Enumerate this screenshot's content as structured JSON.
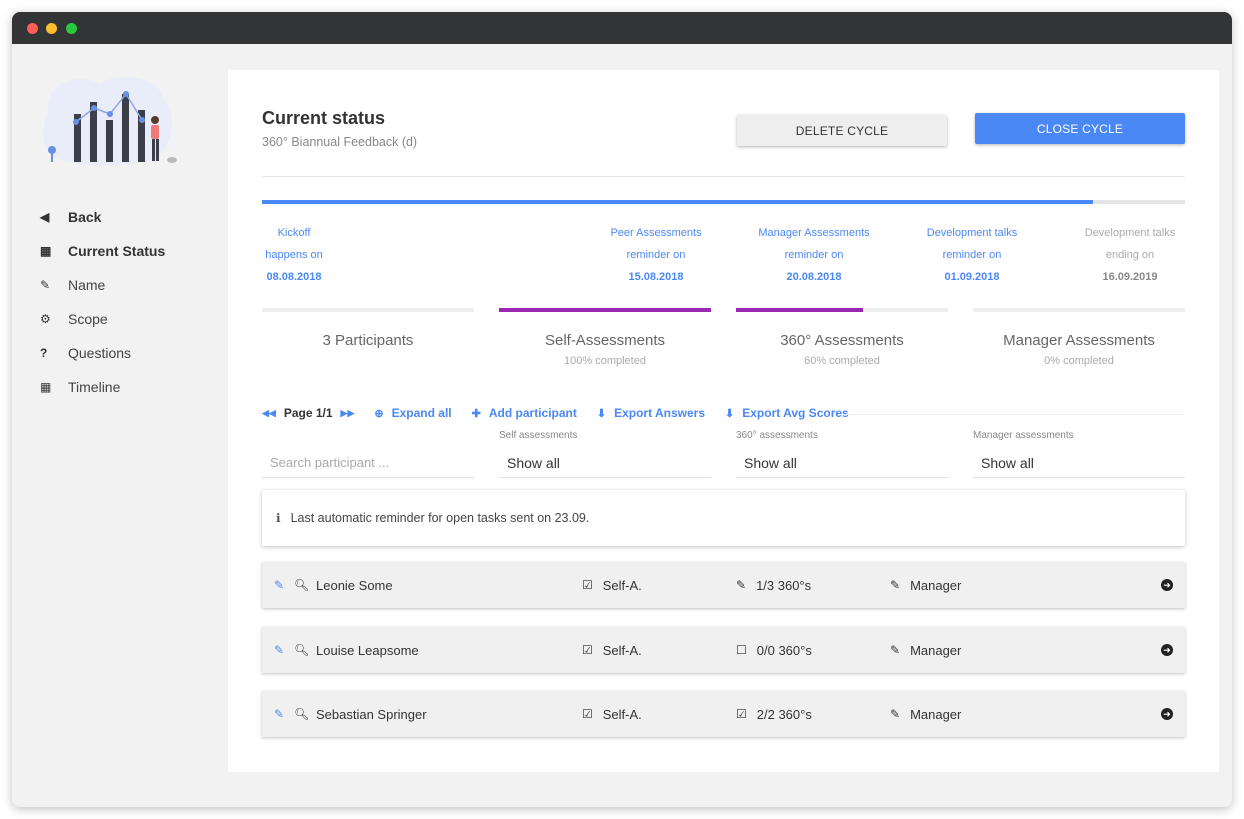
{
  "sidebar": {
    "items": [
      {
        "label": "Back",
        "icon": "caret-left-icon"
      },
      {
        "label": "Current Status",
        "icon": "calendar-icon"
      },
      {
        "label": "Name",
        "icon": "edit-icon"
      },
      {
        "label": "Scope",
        "icon": "gears-icon"
      },
      {
        "label": "Questions",
        "icon": "question-icon"
      },
      {
        "label": "Timeline",
        "icon": "calendar-icon"
      }
    ]
  },
  "header": {
    "title": "Current status",
    "subtitle": "360° Biannual Feedback (d)",
    "delete_label": "DELETE CYCLE",
    "close_label": "CLOSE CYCLE"
  },
  "timeline": {
    "progress": 0.9,
    "milestones": [
      {
        "line1": "Kickoff",
        "line2": "happens on",
        "date": "08.08.2018",
        "state": "past"
      },
      {
        "line1": "Peer Assessments",
        "line2": "reminder on",
        "date": "15.08.2018",
        "state": "past"
      },
      {
        "line1": "Manager Assessments",
        "line2": "reminder on",
        "date": "20.08.2018",
        "state": "past"
      },
      {
        "line1": "Development talks",
        "line2": "reminder on",
        "date": "01.09.2018",
        "state": "past"
      },
      {
        "line1": "Development talks",
        "line2": "ending on",
        "date": "16.09.2019",
        "state": "future"
      }
    ]
  },
  "stats": [
    {
      "label": "3 Participants",
      "sub": "",
      "progress": 0
    },
    {
      "label": "Self-Assessments",
      "sub": "100% completed",
      "progress": 1.0
    },
    {
      "label": "360° Assessments",
      "sub": "60% completed",
      "progress": 0.6
    },
    {
      "label": "Manager Assessments",
      "sub": "0% completed",
      "progress": 0
    }
  ],
  "toolbar": {
    "page_label": "Page 1/1",
    "expand_label": "Expand all",
    "add_label": "Add participant",
    "export_answers_label": "Export Answers",
    "export_avg_label": "Export Avg Scores"
  },
  "filters": {
    "search_placeholder": "Search participant ...",
    "self_label": "Self assessments",
    "self_value": "Show all",
    "three_label": "360° assessments",
    "three_value": "Show all",
    "manager_label": "Manager assessments",
    "manager_value": "Show all"
  },
  "info": {
    "text": "Last automatic reminder for open tasks sent on 23.09."
  },
  "participants": [
    {
      "name": "Leonie Some",
      "self": "Self-A.",
      "three": "1/3 360°s",
      "three_icon": "edit-icon",
      "manager": "Manager"
    },
    {
      "name": "Louise Leapsome",
      "self": "Self-A.",
      "three": "0/0 360°s",
      "three_icon": "empty-square-icon",
      "manager": "Manager"
    },
    {
      "name": "Sebastian Springer",
      "self": "Self-A.",
      "three": "2/2 360°s",
      "three_icon": "checked-square-icon",
      "manager": "Manager"
    }
  ],
  "colors": {
    "accent": "#4a88f5",
    "stat_bar": "#9c27b0"
  }
}
